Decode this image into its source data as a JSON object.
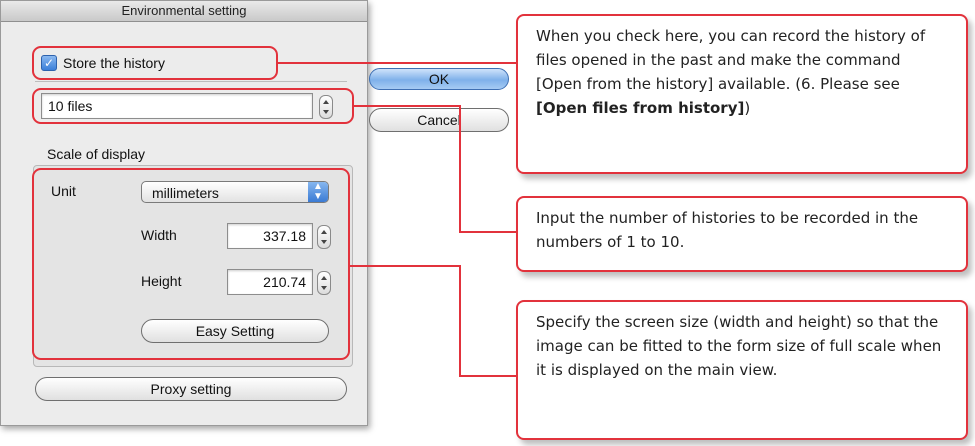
{
  "dialog": {
    "title": "Environmental setting",
    "store_history_label": "Store the history",
    "store_history_checked": true,
    "history_count_value": "10 files",
    "ok_label": "OK",
    "cancel_label": "Cancel",
    "scale_group_label": "Scale of display",
    "unit_label": "Unit",
    "unit_value": "millimeters",
    "width_label": "Width",
    "width_value": "337.18",
    "height_label": "Height",
    "height_value": "210.74",
    "easy_setting_label": "Easy Setting",
    "proxy_setting_label": "Proxy setting"
  },
  "callouts": {
    "history": {
      "text": "When you check here, you can record the history of files opened in the past and make the command [Open from the history] available. (6. Please see ",
      "link": "[Open files from history]",
      "tail": ")"
    },
    "count": {
      "text": "Input the number of histories to be recorded in the numbers of 1 to 10."
    },
    "scale": {
      "text": "Specify the screen size (width and height) so that the image can be fitted to the form size of full scale when it is displayed on the main view."
    }
  },
  "colors": {
    "highlight": "#e2323c",
    "dialog_bg": "#ececec",
    "ok_button": "#7fb1ea"
  }
}
